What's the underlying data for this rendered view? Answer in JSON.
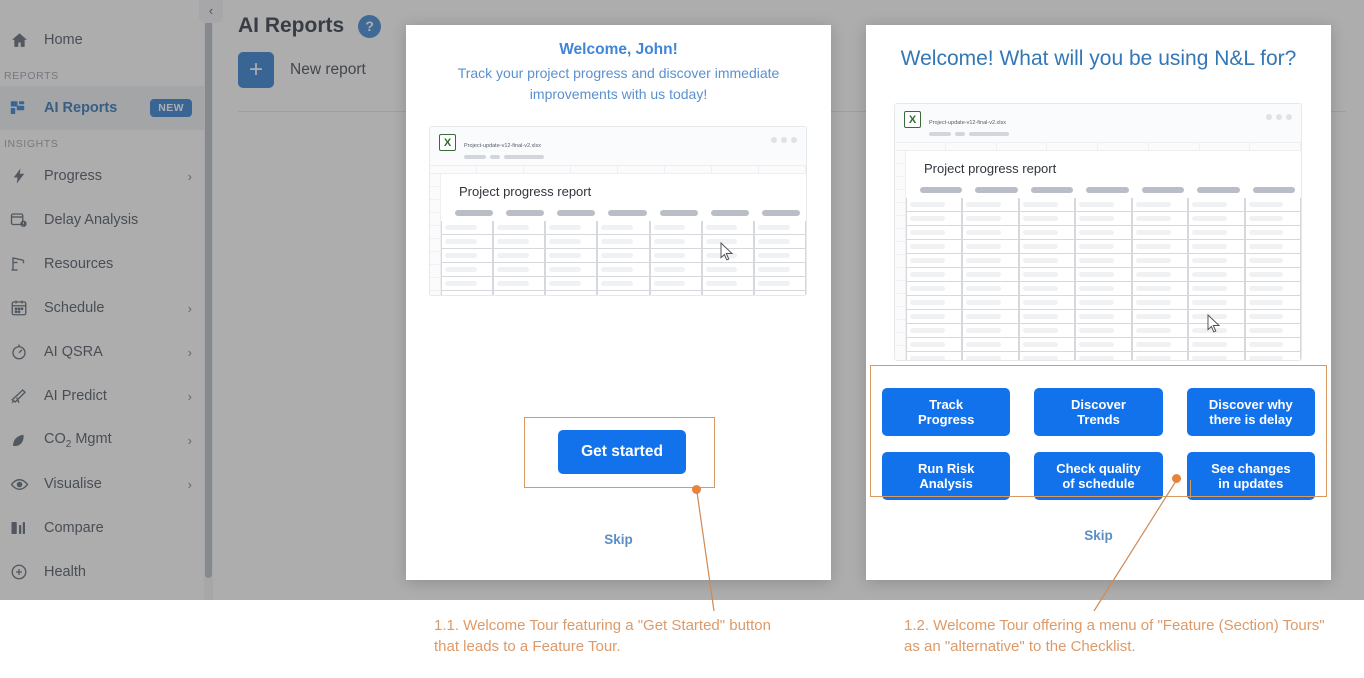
{
  "sidebar": {
    "collapse_icon": "chevron-left-icon",
    "items": [
      {
        "label": "Home",
        "icon": "home-icon",
        "type": "item",
        "chevron": false,
        "badge": null,
        "active": false
      },
      {
        "label": "REPORTS",
        "type": "section"
      },
      {
        "label": "AI Reports",
        "icon": "grid-icon",
        "type": "item",
        "chevron": false,
        "badge": "NEW",
        "active": true
      },
      {
        "label": "INSIGHTS",
        "type": "section"
      },
      {
        "label": "Progress",
        "icon": "lightning-icon",
        "type": "item",
        "chevron": true,
        "badge": null,
        "active": false
      },
      {
        "label": "Delay Analysis",
        "icon": "calendar-alert-icon",
        "type": "item",
        "chevron": false,
        "badge": null,
        "active": false
      },
      {
        "label": "Resources",
        "icon": "crane-icon",
        "type": "item",
        "chevron": false,
        "badge": null,
        "active": false
      },
      {
        "label": "Schedule",
        "icon": "calendar-icon",
        "type": "item",
        "chevron": true,
        "badge": null,
        "active": false
      },
      {
        "label": "AI QSRA",
        "icon": "gauge-icon",
        "type": "item",
        "chevron": true,
        "badge": null,
        "active": false
      },
      {
        "label": "AI Predict",
        "icon": "telescope-icon",
        "type": "item",
        "chevron": true,
        "badge": null,
        "active": false
      },
      {
        "label": "CO2 Mgmt",
        "label_html": "CO<sub>2</sub> Mgmt",
        "icon": "leaf-icon",
        "type": "item",
        "chevron": true,
        "badge": null,
        "active": false
      },
      {
        "label": "Visualise",
        "icon": "eye-icon",
        "type": "item",
        "chevron": true,
        "badge": null,
        "active": false
      },
      {
        "label": "Compare",
        "icon": "compare-icon",
        "type": "item",
        "chevron": false,
        "badge": null,
        "active": false
      },
      {
        "label": "Health",
        "icon": "shield-check-icon",
        "type": "item",
        "chevron": false,
        "badge": null,
        "active": false
      }
    ]
  },
  "header": {
    "page_title": "AI Reports",
    "help_icon_label": "?",
    "new_report_label": "New report",
    "plus_icon_label": "+"
  },
  "dialog1": {
    "title": "Welcome, John!",
    "subtitle": "Track your project progress and discover immediate improvements with us today!",
    "cta_label": "Get started",
    "skip_label": "Skip",
    "sheet": {
      "filename": "Project-update-v12-final-v2.xlsx",
      "heading": "Project progress report",
      "icon": "excel-icon",
      "cursor_icon": "mouse-pointer-icon"
    }
  },
  "dialog2": {
    "title": "Welcome! What will you be using N&L for?",
    "skip_label": "Skip",
    "options": [
      "Track Progress",
      "Discover Trends",
      "Discover why there is delay",
      "Run Risk Analysis",
      "Check quality of schedule",
      "See changes in updates"
    ],
    "options_lines": [
      [
        "Track",
        "Progress"
      ],
      [
        "Discover",
        "Trends"
      ],
      [
        "Discover why",
        "there is delay"
      ],
      [
        "Run Risk",
        "Analysis"
      ],
      [
        "Check quality",
        "of schedule"
      ],
      [
        "See changes",
        "in updates"
      ]
    ],
    "sheet": {
      "filename": "Project-update-v12-final-v2.xlsx",
      "heading": "Project progress report",
      "icon": "excel-icon",
      "cursor_icon": "mouse-pointer-icon"
    }
  },
  "annotations": {
    "caption1": "1.1. Welcome Tour featuring a \"Get Started\" button that leads to a Feature Tour.",
    "caption2": "1.2. Welcome Tour offering a menu of \"Feature (Section) Tours\" as an \"alternative\" to the Checklist."
  },
  "colors": {
    "accent_blue": "#1272ec",
    "sidebar_active_blue": "#2c6fb5",
    "annotation_orange": "#e8833c",
    "annotation_text": "#dd9a68",
    "highlight_border": "#d79a63",
    "backdrop": "rgba(74,74,74,.45)"
  }
}
